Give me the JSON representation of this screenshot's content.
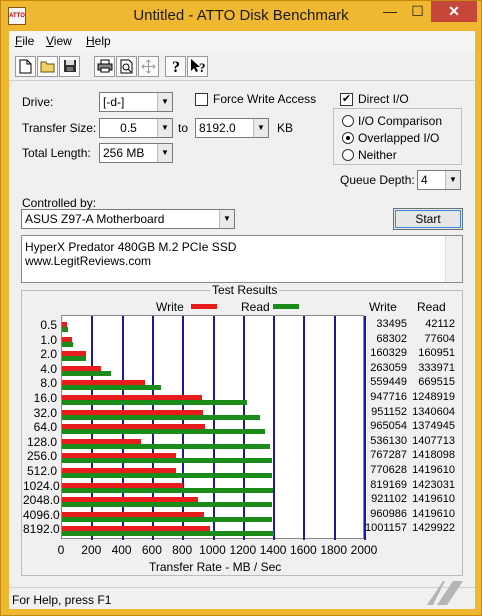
{
  "window": {
    "title": "Untitled - ATTO Disk Benchmark",
    "app_icon_text": "ATTO",
    "minimize_glyph": "—",
    "maximize_glyph": "☐",
    "close_glyph": "✕"
  },
  "menu": {
    "items": [
      {
        "first": "F",
        "rest": "ile"
      },
      {
        "first": "V",
        "rest": "iew"
      },
      {
        "first": "H",
        "rest": "elp"
      }
    ]
  },
  "toolbar": {
    "buttons": [
      "new-icon",
      "open-icon",
      "save-icon",
      "print-icon",
      "print-preview-icon",
      "move-icon",
      "help-icon",
      "context-help-icon"
    ]
  },
  "settings": {
    "drive_label": "Drive:",
    "drive_value": "[-d-]",
    "force_write_label": "Force Write Access",
    "force_write_checked": false,
    "direct_io_label": "Direct I/O",
    "direct_io_checked": true,
    "transfer_size_label": "Transfer Size:",
    "transfer_from": "0.5",
    "to_label": "to",
    "transfer_to": "8192.0",
    "kb_label": "KB",
    "total_length_label": "Total Length:",
    "total_length_value": "256 MB",
    "io_comparison_label": "I/O Comparison",
    "overlapped_io_label": "Overlapped I/O",
    "neither_label": "Neither",
    "selected_io_mode": "overlapped",
    "queue_depth_label": "Queue Depth:",
    "queue_depth_value": "4",
    "controlled_by_label": "Controlled by:",
    "controlled_by_value": "ASUS Z97-A Motherboard",
    "start_label": "Start",
    "description_line1": "HyperX Predator 480GB M.2 PCIe SSD",
    "description_line2": "www.LegitReviews.com"
  },
  "results": {
    "title": "Test Results",
    "write_legend": "Write",
    "read_legend": "Read",
    "write_color": "#e81c1c",
    "read_color": "#1a8c1a",
    "grid_color": "#1a1aa6",
    "write_col_header": "Write",
    "read_col_header": "Read",
    "x_axis_label": "Transfer Rate - MB / Sec",
    "x_ticks": [
      "0",
      "200",
      "400",
      "600",
      "800",
      "1000",
      "1200",
      "1400",
      "1600",
      "1800",
      "2000"
    ]
  },
  "chart_data": {
    "type": "bar",
    "orientation": "horizontal",
    "title": "Test Results",
    "xlabel": "Transfer Rate - MB / Sec",
    "xlim": [
      0,
      2000
    ],
    "categories": [
      "0.5",
      "1.0",
      "2.0",
      "4.0",
      "8.0",
      "16.0",
      "32.0",
      "64.0",
      "128.0",
      "256.0",
      "512.0",
      "1024.0",
      "2048.0",
      "4096.0",
      "8192.0"
    ],
    "series": [
      {
        "name": "Write",
        "values_kbps": [
          "33495",
          "68302",
          "160329",
          "263059",
          "559449",
          "947716",
          "951152",
          "965054",
          "536130",
          "767287",
          "770628",
          "819169",
          "921102",
          "960986",
          "1001157"
        ]
      },
      {
        "name": "Read",
        "values_kbps": [
          "42112",
          "77604",
          "160951",
          "333971",
          "669515",
          "1248919",
          "1340604",
          "1374945",
          "1407713",
          "1418098",
          "1419610",
          "1423031",
          "1419610",
          "1419610",
          "1429922"
        ]
      }
    ]
  },
  "statusbar": {
    "text": "For Help, press F1"
  }
}
